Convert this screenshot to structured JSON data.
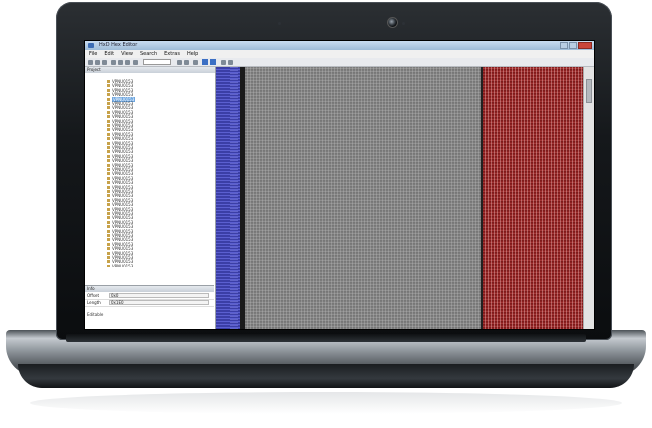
{
  "window": {
    "app_title": "HxD Hex Editor",
    "doc_title": ""
  },
  "menu": [
    "File",
    "Edit",
    "View",
    "Search",
    "Extras",
    "Help"
  ],
  "left_pane": {
    "header": "Project",
    "root_label": "",
    "items_count": 43,
    "selected_index": 4,
    "item_label": "VPNU0153"
  },
  "props": {
    "header": "Info",
    "rows": [
      {
        "key": "Offset",
        "value": "0x0"
      },
      {
        "key": "Length",
        "value": "0x1E0"
      }
    ],
    "note": "Editable"
  },
  "colors": {
    "address_column": "#3b3ea6",
    "hex_area": "#7b7b7b",
    "ascii_area": "#8a1f1f",
    "selection": "#6fa7e0"
  }
}
